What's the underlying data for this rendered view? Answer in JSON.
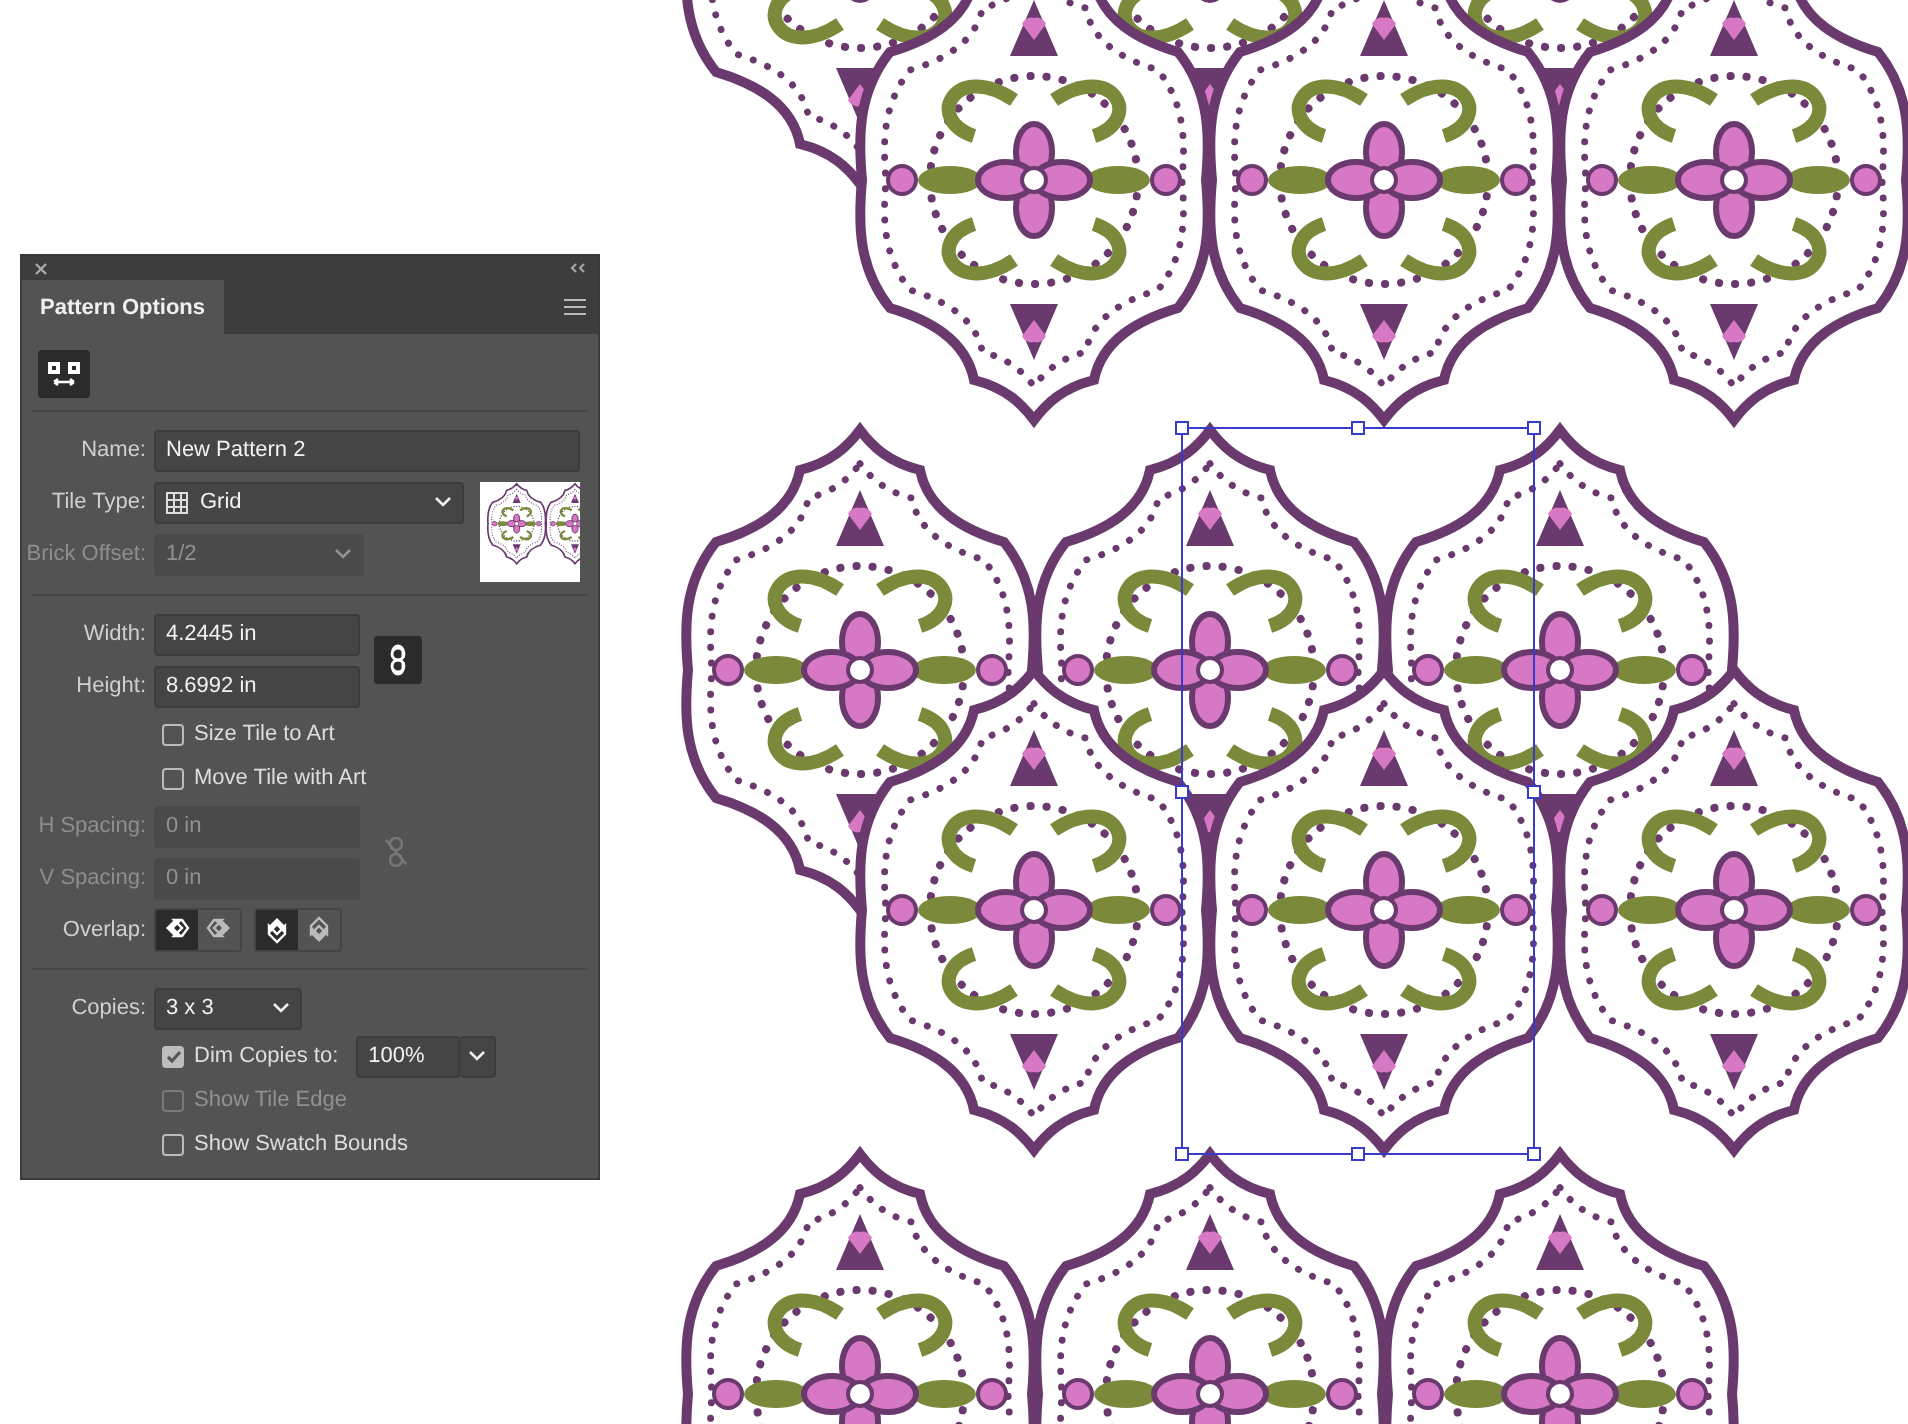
{
  "panel": {
    "tab": {
      "label": "Pattern Options",
      "selected": true
    },
    "name": {
      "label": "Name:",
      "value": "New Pattern 2"
    },
    "tile_type": {
      "label": "Tile Type:",
      "value": "Grid"
    },
    "brick_offset": {
      "label": "Brick Offset:",
      "value": "1/2",
      "disabled": true
    },
    "width": {
      "label": "Width:",
      "value": "4.2445 in"
    },
    "height": {
      "label": "Height:",
      "value": "8.6992 in"
    },
    "size_tile_to_art": {
      "label": "Size Tile to Art",
      "checked": false,
      "disabled": false
    },
    "move_tile_with_art": {
      "label": "Move Tile with Art",
      "checked": false,
      "disabled": false
    },
    "h_spacing": {
      "label": "H Spacing:",
      "value": "0 in",
      "disabled": true
    },
    "v_spacing": {
      "label": "V Spacing:",
      "value": "0 in",
      "disabled": true
    },
    "overlap": {
      "label": "Overlap:",
      "groups": [
        [
          {
            "kind": "left",
            "selected": true
          },
          {
            "kind": "right",
            "selected": false
          }
        ],
        [
          {
            "kind": "top",
            "selected": true
          },
          {
            "kind": "bottom",
            "selected": false
          }
        ]
      ]
    },
    "copies": {
      "label": "Copies:",
      "value": "3 x 3"
    },
    "dim_copies": {
      "label": "Dim Copies to:",
      "checked": true,
      "disabled": false,
      "value": "100%"
    },
    "show_tile_edge": {
      "label": "Show Tile Edge",
      "checked": false,
      "disabled": true
    },
    "show_swatch_bounds": {
      "label": "Show Swatch Bounds",
      "checked": false,
      "disabled": false
    }
  }
}
